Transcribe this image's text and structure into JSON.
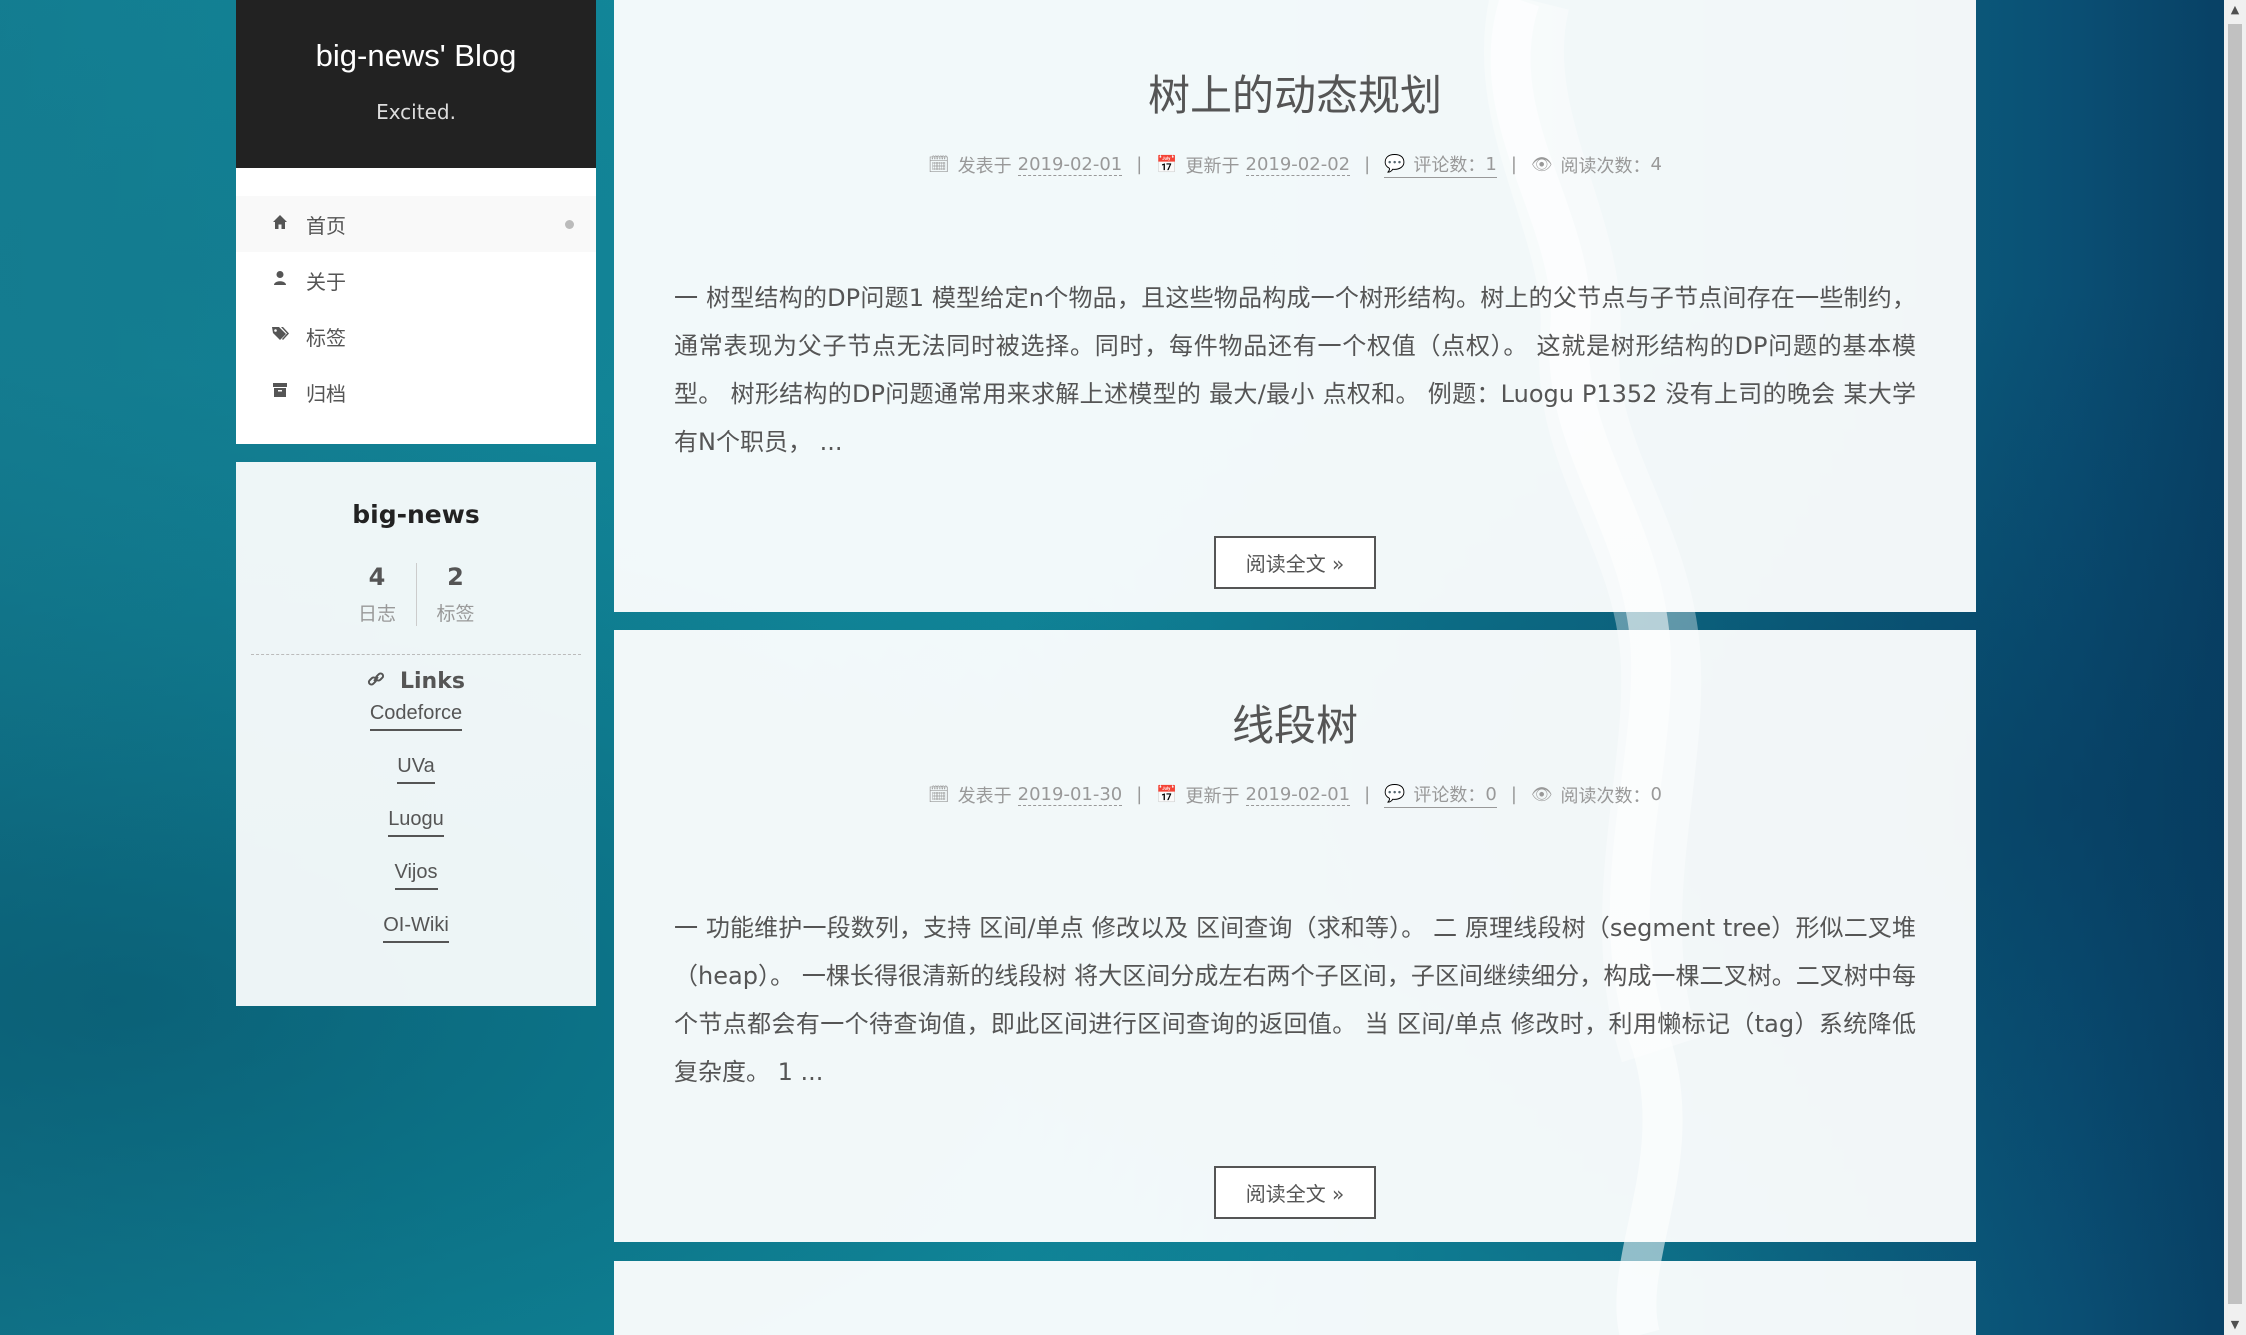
{
  "brand": {
    "title": "big-news' Blog",
    "subtitle": "Excited."
  },
  "menu": {
    "items": [
      {
        "label": "首页",
        "icon": "home-icon"
      },
      {
        "label": "关于",
        "icon": "user-icon"
      },
      {
        "label": "标签",
        "icon": "tags-icon"
      },
      {
        "label": "归档",
        "icon": "archive-icon"
      }
    ]
  },
  "profile": {
    "author": "big-news",
    "stats": [
      {
        "count": "4",
        "label": "日志"
      },
      {
        "count": "2",
        "label": "标签"
      }
    ],
    "links_title": "Links",
    "links": [
      "Codeforce",
      "UVa",
      "Luogu",
      "Vijos",
      "OI-Wiki"
    ]
  },
  "posts": [
    {
      "title": "树上的动态规划",
      "posted_label": "发表于",
      "posted_date": "2019-02-01",
      "updated_label": "更新于",
      "updated_date": "2019-02-02",
      "comments_label": "评论数：",
      "comments": "1",
      "views_label": "阅读次数：",
      "views": "4",
      "excerpt": "一 树型结构的DP问题1 模型给定n个物品，且这些物品构成一个树形结构。树上的父节点与子节点间存在一些制约，通常表现为父子节点无法同时被选择。同时，每件物品还有一个权值（点权）。 这就是树形结构的DP问题的基本模型。 树形结构的DP问题通常用来求解上述模型的 最大/最小 点权和。 例题：Luogu P1352 没有上司的晚会 某大学有N个职员， ...",
      "read_more": "阅读全文 »"
    },
    {
      "title": "线段树",
      "posted_label": "发表于",
      "posted_date": "2019-01-30",
      "updated_label": "更新于",
      "updated_date": "2019-02-01",
      "comments_label": "评论数：",
      "comments": "0",
      "views_label": "阅读次数：",
      "views": "0",
      "excerpt": "一 功能维护一段数列，支持 区间/单点 修改以及 区间查询（求和等）。 二 原理线段树（segment tree）形似二叉堆（heap）。 一棵长得很清新的线段树 将大区间分成左右两个子区间，子区间继续细分，构成一棵二叉树。二叉树中每个节点都会有一个待查询值，即此区间进行区间查询的返回值。 当 区间/单点 修改时，利用懒标记（tag）系统降低复杂度。 1 ...",
      "read_more": "阅读全文 »"
    }
  ]
}
